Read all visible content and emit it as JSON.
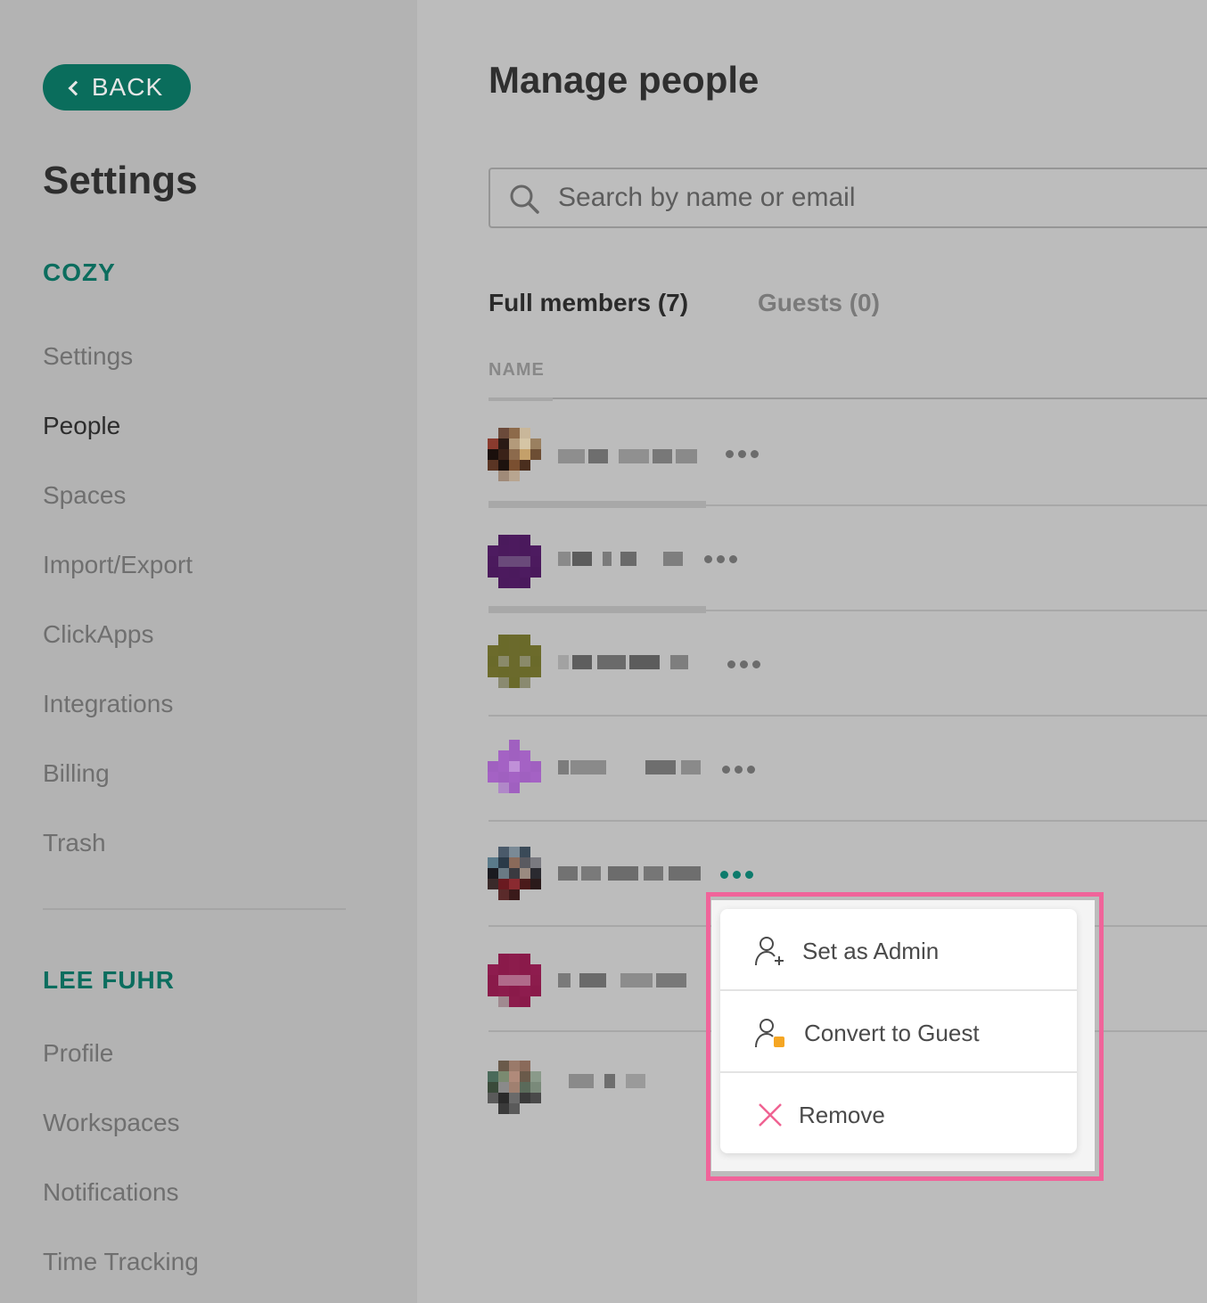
{
  "sidebar": {
    "back_label": "BACK",
    "title": "Settings",
    "workspace_section": "COZY",
    "workspace_items": [
      "Settings",
      "People",
      "Spaces",
      "Import/Export",
      "ClickApps",
      "Integrations",
      "Billing",
      "Trash"
    ],
    "active_item": "People",
    "user_section": "LEE FUHR",
    "user_items": [
      "Profile",
      "Workspaces",
      "Notifications",
      "Time Tracking"
    ]
  },
  "main": {
    "title": "Manage people",
    "search_placeholder": "Search by name or email",
    "tabs": [
      "Full members (7)",
      "Guests (0)"
    ],
    "column_header": "NAME"
  },
  "context_menu": {
    "items": [
      {
        "label": "Set as Admin",
        "icon": "user-plus-icon"
      },
      {
        "label": "Convert to Guest",
        "icon": "user-guest-icon"
      },
      {
        "label": "Remove",
        "icon": "close-icon"
      }
    ]
  },
  "colors": {
    "accent": "#0a6d5c",
    "highlight": "#f0649a",
    "guest_badge": "#f5a623",
    "remove_icon": "#f06292"
  }
}
